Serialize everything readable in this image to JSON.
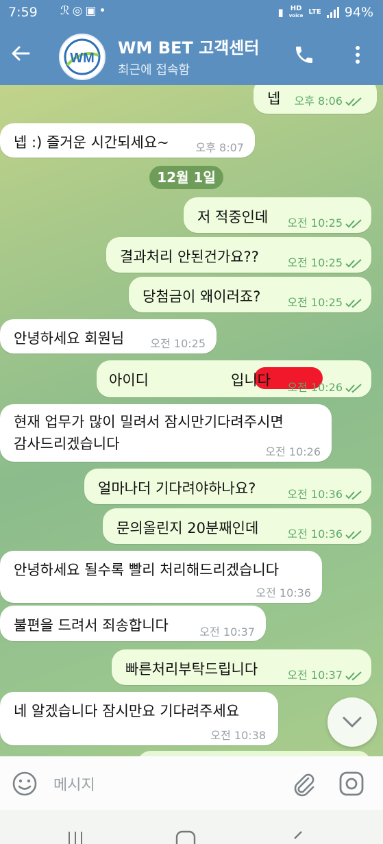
{
  "status_bar": {
    "time": "7:59",
    "network_top": "HD",
    "network_bottom": "voice",
    "network_type": "LTE",
    "battery": "94%"
  },
  "header": {
    "title": "WM BET 고객센터",
    "subtitle": "최근에 접속함",
    "avatar_text": "WM"
  },
  "chat": {
    "date_divider": "12월 1일",
    "messages": [
      {
        "dir": "out",
        "text": "넵",
        "time": "오후 8:06"
      },
      {
        "dir": "in",
        "text": "넵 :) 즐거운 시간되세요~",
        "time": "오후 8:07"
      },
      {
        "dir": "out",
        "text": "저 적중인데",
        "time": "오전 10:25"
      },
      {
        "dir": "out",
        "text": "결과처리 안된건가요??",
        "time": "오전 10:25"
      },
      {
        "dir": "out",
        "text": "당첨금이 왜이러죠?",
        "time": "오전 10:25"
      },
      {
        "dir": "in",
        "text": "안녕하세요 회원님",
        "time": "오전 10:25"
      },
      {
        "dir": "out",
        "text_before": "아이디",
        "text_after": "입니다",
        "time": "오전 10:26"
      },
      {
        "dir": "in",
        "text_line1": "현재 업무가 많이 밀려서 잠시만기다려주시면",
        "text_line2": "감사드리겠습니다",
        "time": "오전 10:26"
      },
      {
        "dir": "out",
        "text": "얼마나더 기다려야하나요?",
        "time": "오전 10:36"
      },
      {
        "dir": "out",
        "text": "문의올린지 20분째인데",
        "time": "오전 10:36"
      },
      {
        "dir": "in",
        "text": "안녕하세요 될수록 빨리 처리해드리겠습니다",
        "time": "오전 10:36"
      },
      {
        "dir": "in",
        "text": "불편을 드려서 죄송합니다",
        "time": "오전 10:37"
      },
      {
        "dir": "out",
        "text": "빠른처리부탁드립니다",
        "time": "오전 10:37"
      },
      {
        "dir": "in",
        "text": "네 알겠습니다 잠시만요 기다려주세요",
        "time": "오전 10:38"
      }
    ]
  },
  "input": {
    "placeholder": "메시지"
  },
  "colors": {
    "header": "#5a8fc0",
    "outgoing_bubble": "#effdde",
    "incoming_bubble": "#ffffff",
    "check_green": "#5fa96a"
  }
}
